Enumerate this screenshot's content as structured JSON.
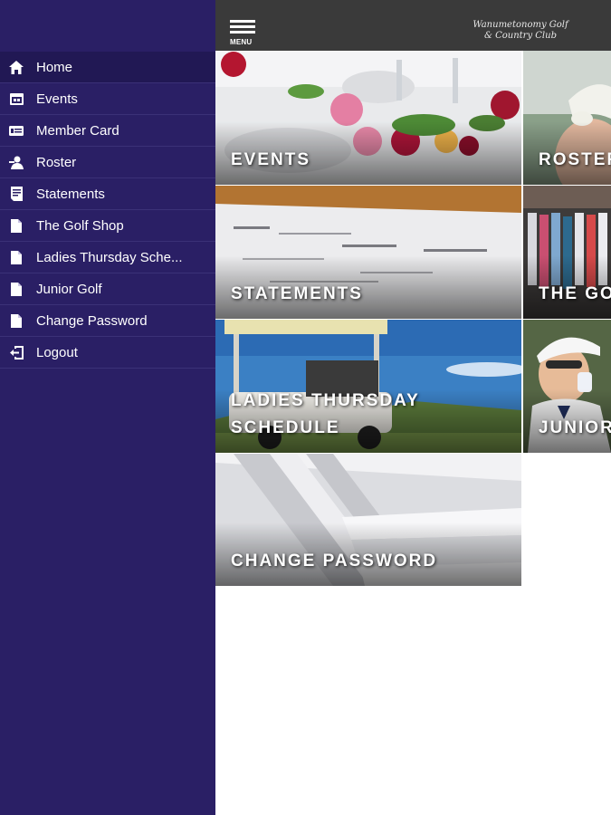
{
  "header": {
    "menu_label": "MENU",
    "brand_line1": "Wanumetonomy Golf",
    "brand_line2": "& Country Club"
  },
  "sidebar": {
    "items": [
      {
        "label": "Home",
        "icon": "home-icon"
      },
      {
        "label": "Events",
        "icon": "calendar-icon"
      },
      {
        "label": "Member Card",
        "icon": "card-icon"
      },
      {
        "label": "Roster",
        "icon": "user-icon"
      },
      {
        "label": "Statements",
        "icon": "statement-icon"
      },
      {
        "label": "The Golf Shop",
        "icon": "document-icon"
      },
      {
        "label": "Ladies Thursday Sche...",
        "icon": "document-icon"
      },
      {
        "label": "Junior Golf",
        "icon": "document-icon"
      },
      {
        "label": "Change Password",
        "icon": "document-icon"
      },
      {
        "label": "Logout",
        "icon": "logout-icon"
      }
    ]
  },
  "tiles": {
    "events": "EVENTS",
    "roster": "ROSTER",
    "statements": "STATEMENTS",
    "golf_shop": "THE GOLF SHOP",
    "ladies_thursday": "LADIES THURSDAY SCHEDULE",
    "junior_golf": "JUNIOR GOLF",
    "change_password": "CHANGE PASSWORD"
  },
  "colors": {
    "sidebar": "#2a1f65",
    "sidebar_active": "#211854",
    "header": "#3a3a3a"
  }
}
